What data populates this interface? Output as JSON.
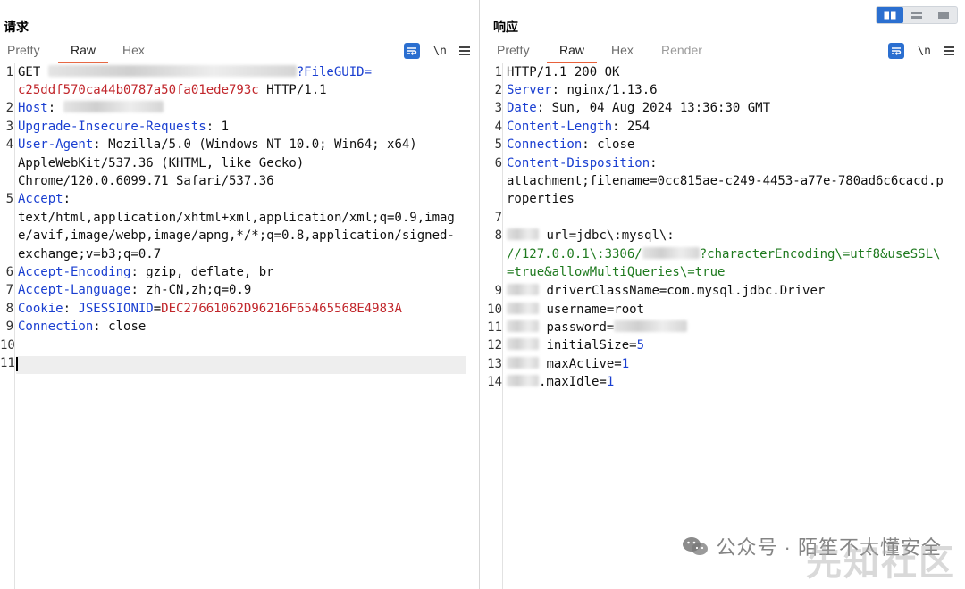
{
  "request": {
    "title": "请求",
    "tabs": {
      "pretty": "Pretty",
      "raw": "Raw",
      "hex": "Hex"
    },
    "newline_toggle": "\\n",
    "lines": {
      "l1a_method": "GET ",
      "l1a_file": "?FileGUID=",
      "l1b_guid": "c25ddf570ca44b0787a50fa01ede793c",
      "l1b_proto": " HTTP/1.1",
      "l2_key": "Host",
      "l3_key": "Upgrade-Insecure-Requests",
      "l3_val": " 1",
      "l4_key": "User-Agent",
      "l4_val": " Mozilla/5.0 (Windows NT 10.0; Win64; x64)",
      "l4_c2": "AppleWebKit/537.36 (KHTML, like Gecko)",
      "l4_c3": "Chrome/120.0.6099.71 Safari/537.36",
      "l5_key": "Accept",
      "l5_c1": "text/html,application/xhtml+xml,application/xml;q=0.9,imag",
      "l5_c2": "e/avif,image/webp,image/apng,*/*;q=0.8,application/signed-",
      "l5_c3": "exchange;v=b3;q=0.7",
      "l6_key": "Accept-Encoding",
      "l6_val": " gzip, deflate, br",
      "l7_key": "Accept-Language",
      "l7_val": " zh-CN,zh;q=0.9",
      "l8_key": "Cookie",
      "l8_ckey": "JSESSIONID",
      "l8_cval": "DEC27661062D96216F65465568E4983A",
      "l9_key": "Connection",
      "l9_val": " close"
    }
  },
  "response": {
    "title": "响应",
    "tabs": {
      "pretty": "Pretty",
      "raw": "Raw",
      "hex": "Hex",
      "render": "Render"
    },
    "newline_toggle": "\\n",
    "lines": {
      "l1": "HTTP/1.1 200 OK",
      "l2_key": "Server",
      "l2_val": " nginx/1.13.6",
      "l3_key": "Date",
      "l3_val": " Sun, 04 Aug 2024 13:36:30 GMT",
      "l4_key": "Content-Length",
      "l4_val": " 254",
      "l5_key": "Connection",
      "l5_val": " close",
      "l6_key": "Content-Disposition",
      "l6_c1": "attachment;filename=0cc815ae-c249-4453-a77e-780ad6c6cacd.p",
      "l6_c2": "roperties",
      "l8_a": "url=jdbc\\:mysql\\:",
      "l8_b1": "//127.0.0.1\\:3306/",
      "l8_b2": "?characterEncoding\\=utf8&useSSL\\",
      "l8_c": "=true&allowMultiQueries\\=true",
      "l9": "driverClassName=com.mysql.jdbc.Driver",
      "l10": "username=root",
      "l11": "password=",
      "l12_k": "initialSize=",
      "l12_v": "5",
      "l13_k": "maxActive=",
      "l13_v": "1",
      "l14_k": ".maxIdle=",
      "l14_v": "1"
    }
  },
  "watermark": {
    "text": "公众号 · 陌笙不太懂安全",
    "site": "先知社区"
  },
  "colors": {
    "accent": "#2b6fd0",
    "tab_underline": "#e8613b",
    "key": "#1a3fd1",
    "value_red": "#c1262b",
    "value_green": "#1f7a1f"
  }
}
